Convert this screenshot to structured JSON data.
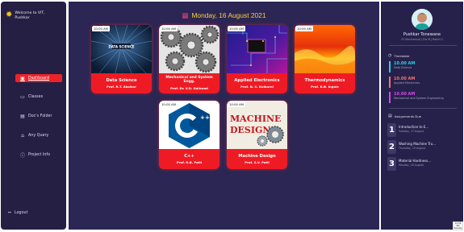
{
  "sidebar": {
    "welcome": "Welcome to VIT,",
    "user": "Pushkar",
    "items": [
      {
        "label": "Dashboard",
        "icon": "dashboard-icon"
      },
      {
        "label": "Classes",
        "icon": "classes-icon"
      },
      {
        "label": "Doc's Folder",
        "icon": "document-icon"
      },
      {
        "label": "Any Query",
        "icon": "query-icon"
      },
      {
        "label": "Project Info",
        "icon": "info-icon"
      }
    ],
    "logout": "Logout"
  },
  "main": {
    "date": "Monday, 16 August 2021",
    "cards": [
      {
        "time": "10:00 AM",
        "name": "Data Science",
        "prof": "Prof. R.T. Akolkar"
      },
      {
        "time": "10:00 AM",
        "name": "Mechanical and System Engg.",
        "prof": "Prof. Dr. V.D. Gaikwad"
      },
      {
        "time": "10:00 AM",
        "name": "Applied Electronics",
        "prof": "Prof. N. S. Kulkarni"
      },
      {
        "time": "10:00 AM",
        "name": "Thermodynamics",
        "prof": "Prof. K.B. Ingale"
      },
      {
        "time": "10:00 AM",
        "name": "C++",
        "prof": "Prof. R.B. Patil"
      },
      {
        "time": "10:00 AM",
        "name": "Machine Design",
        "prof": "Prof. S.V. Patil"
      }
    ],
    "image_text": {
      "ds": "DATA SCIENCE",
      "md1": "MACHINE",
      "md2": "DESIGN"
    }
  },
  "right": {
    "name": "Pushkar Tonewane",
    "subtitle": "SY Mechanical | Div B | Batch 2",
    "timetable_title": "Timetable",
    "timetable": [
      {
        "time": "10.00 AM",
        "subject": "Data Science",
        "color": "#22d3ee"
      },
      {
        "time": "10.00 AM",
        "subject": "Applied Electronics",
        "color": "#f87171"
      },
      {
        "time": "10.00 AM",
        "subject": "Mechanical and System Engineering",
        "color": "#d946ef"
      }
    ],
    "assign_title": "Assignments Due",
    "assignments": [
      {
        "num": "1",
        "title": "Introduction to E...",
        "date": "Tuesday, 17 August"
      },
      {
        "num": "2",
        "title": "Washing Machine Tru...",
        "date": "Thursday, 19 August"
      },
      {
        "num": "3",
        "title": "Material Hardness...",
        "date": "Monday, 16 August"
      }
    ]
  },
  "corner": {
    "time": "12:36 PM",
    "day": "Tuesday"
  }
}
